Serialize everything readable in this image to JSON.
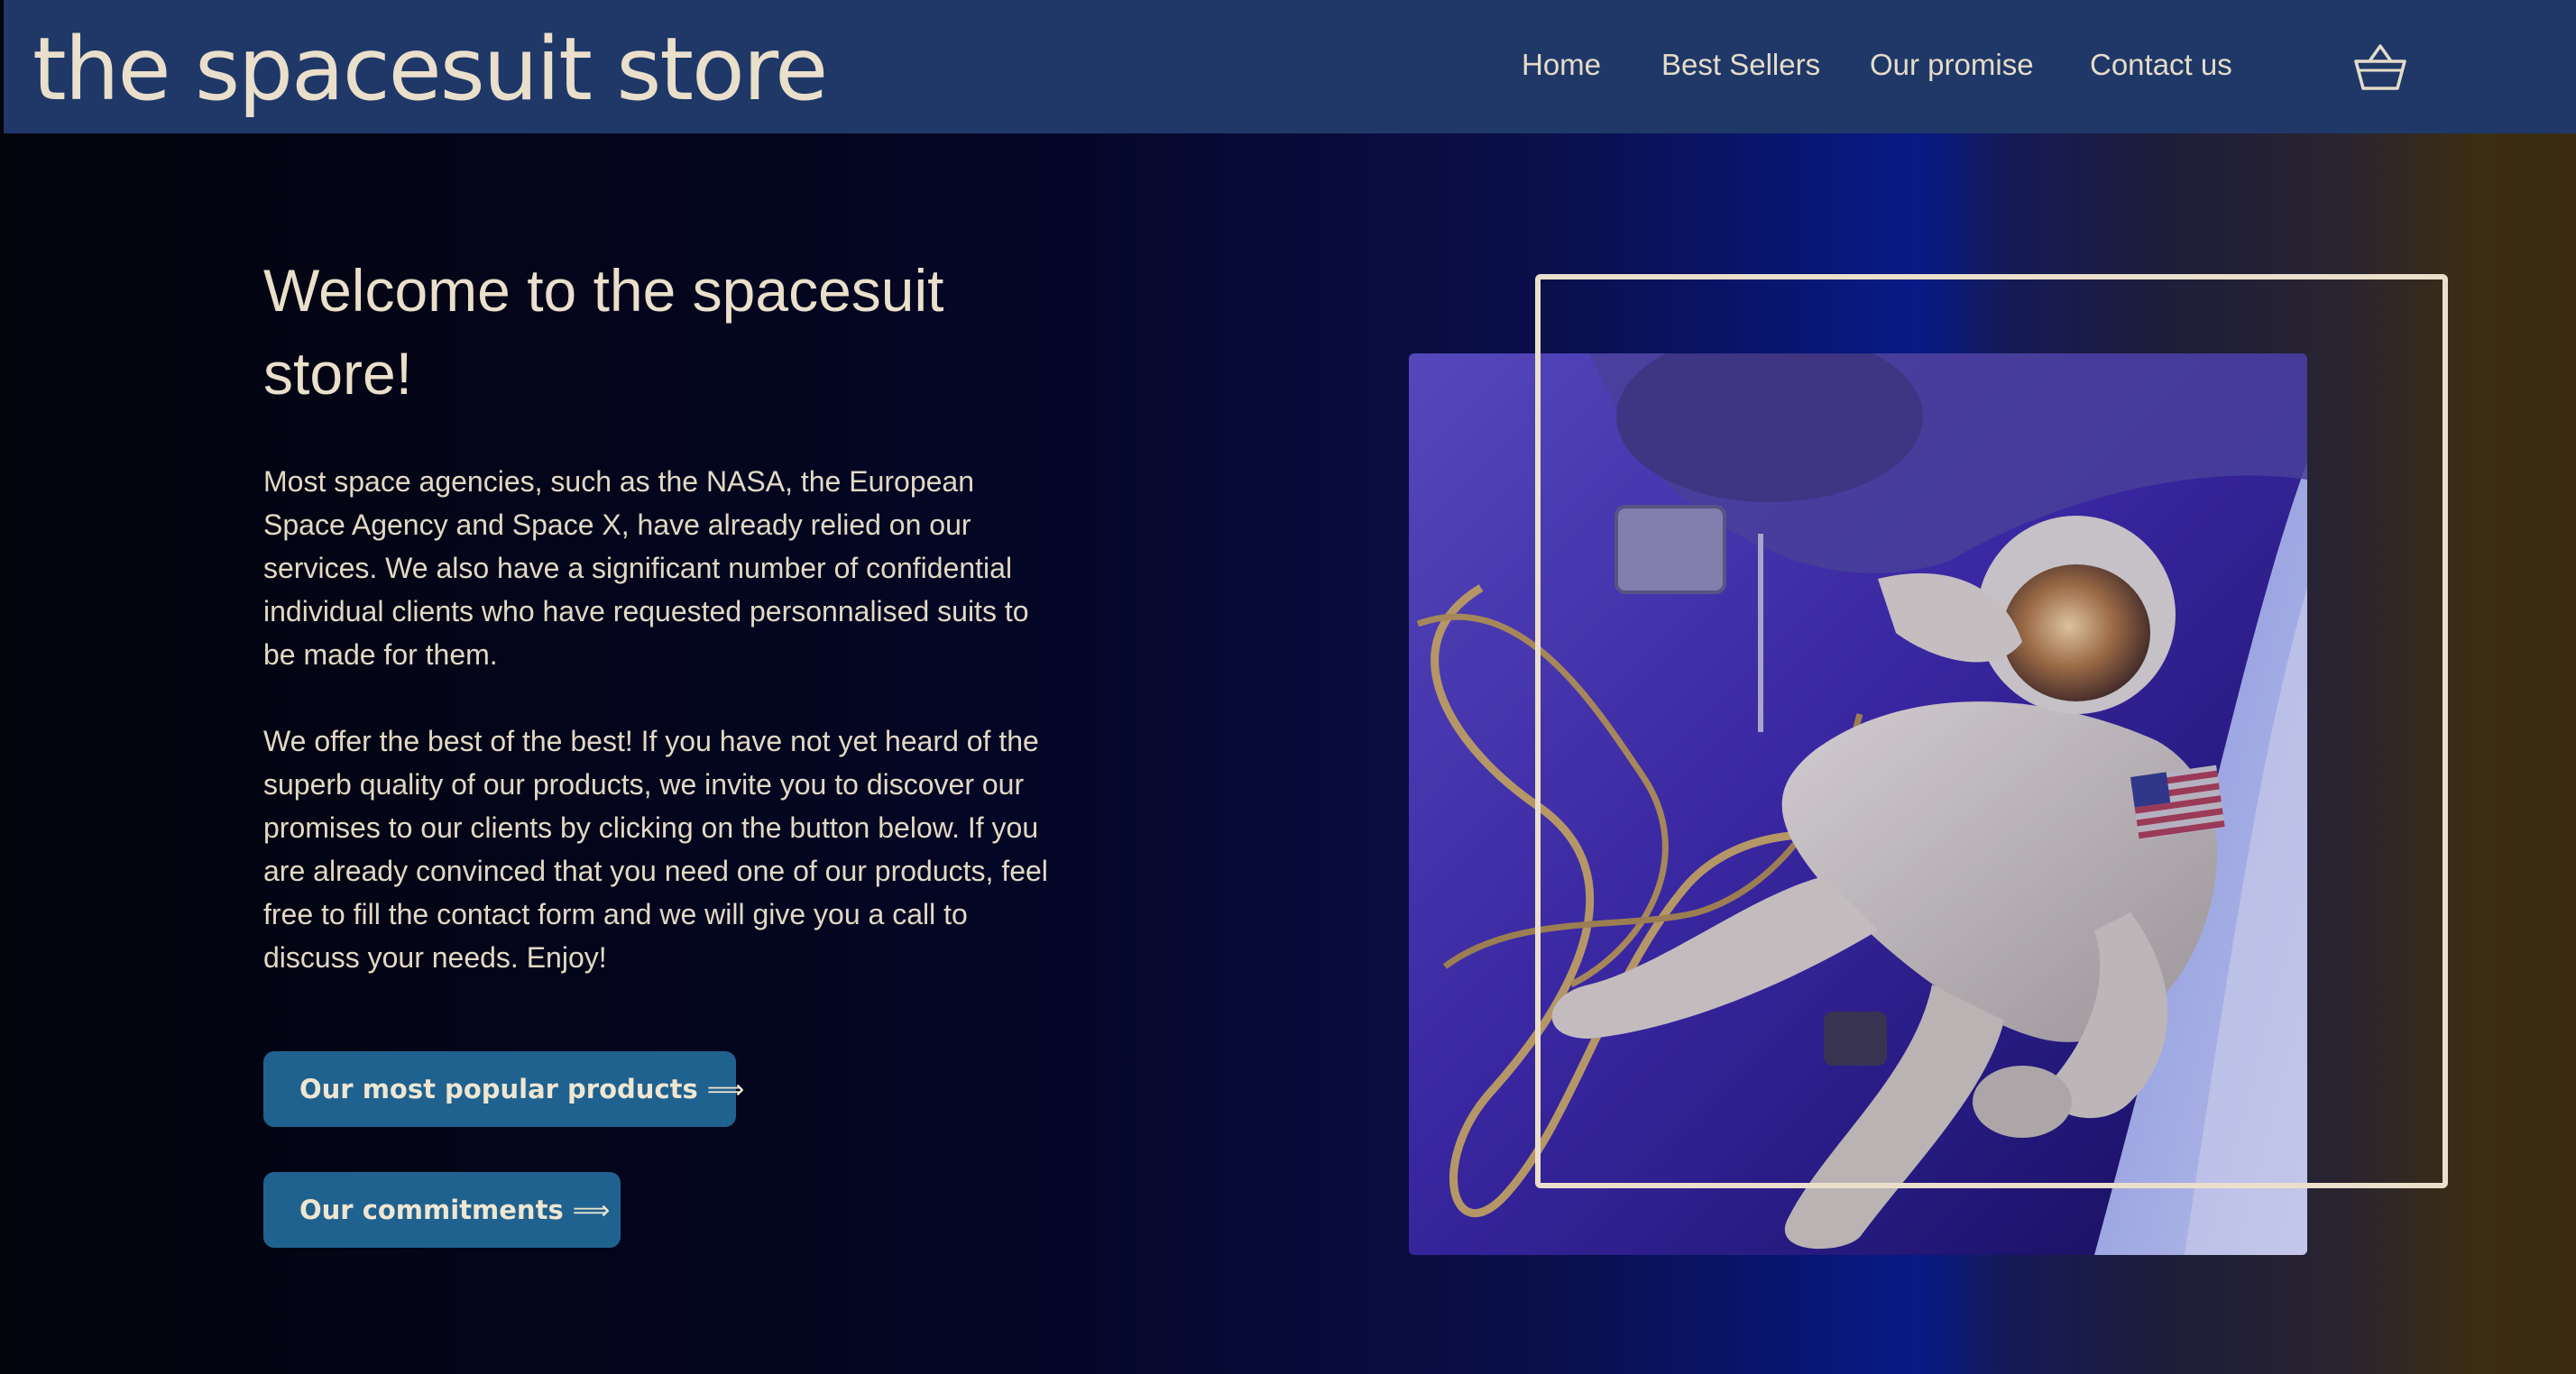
{
  "header": {
    "brand": "the spacesuit store",
    "nav": [
      {
        "label": "Home"
      },
      {
        "label": "Best Sellers"
      },
      {
        "label": "Our promise"
      },
      {
        "label": "Contact us"
      }
    ],
    "cart_icon": "basket-icon"
  },
  "hero": {
    "title": "Welcome to the spacesuit store!",
    "paragraph_1": "Most space agencies, such as the NASA, the European Space Agency and Space X, have already relied on our services. We also have a significant number of confidential individual clients who have requested personnalised suits to be made for them.",
    "paragraph_2": "We offer the best of the best! If you have not yet heard of the superb quality of our products, we invite you to discover our promises to our clients by clicking on the button below. If you are already convinced that you need one of our products, feel free to fill the contact form and we will give you a call to discuss your needs. Enjoy!",
    "buttons": [
      {
        "label": "Our most popular products",
        "icon": "long-arrow-right-icon",
        "glyph": "⟹"
      },
      {
        "label": "Our commitments",
        "icon": "long-arrow-right-icon",
        "glyph": "⟹"
      }
    ],
    "image_subject": "astronaut-spacewalk-image"
  },
  "colors": {
    "header_bg": "#1f3868",
    "text_cream": "#eadfca",
    "button_bg": "#20628f"
  }
}
